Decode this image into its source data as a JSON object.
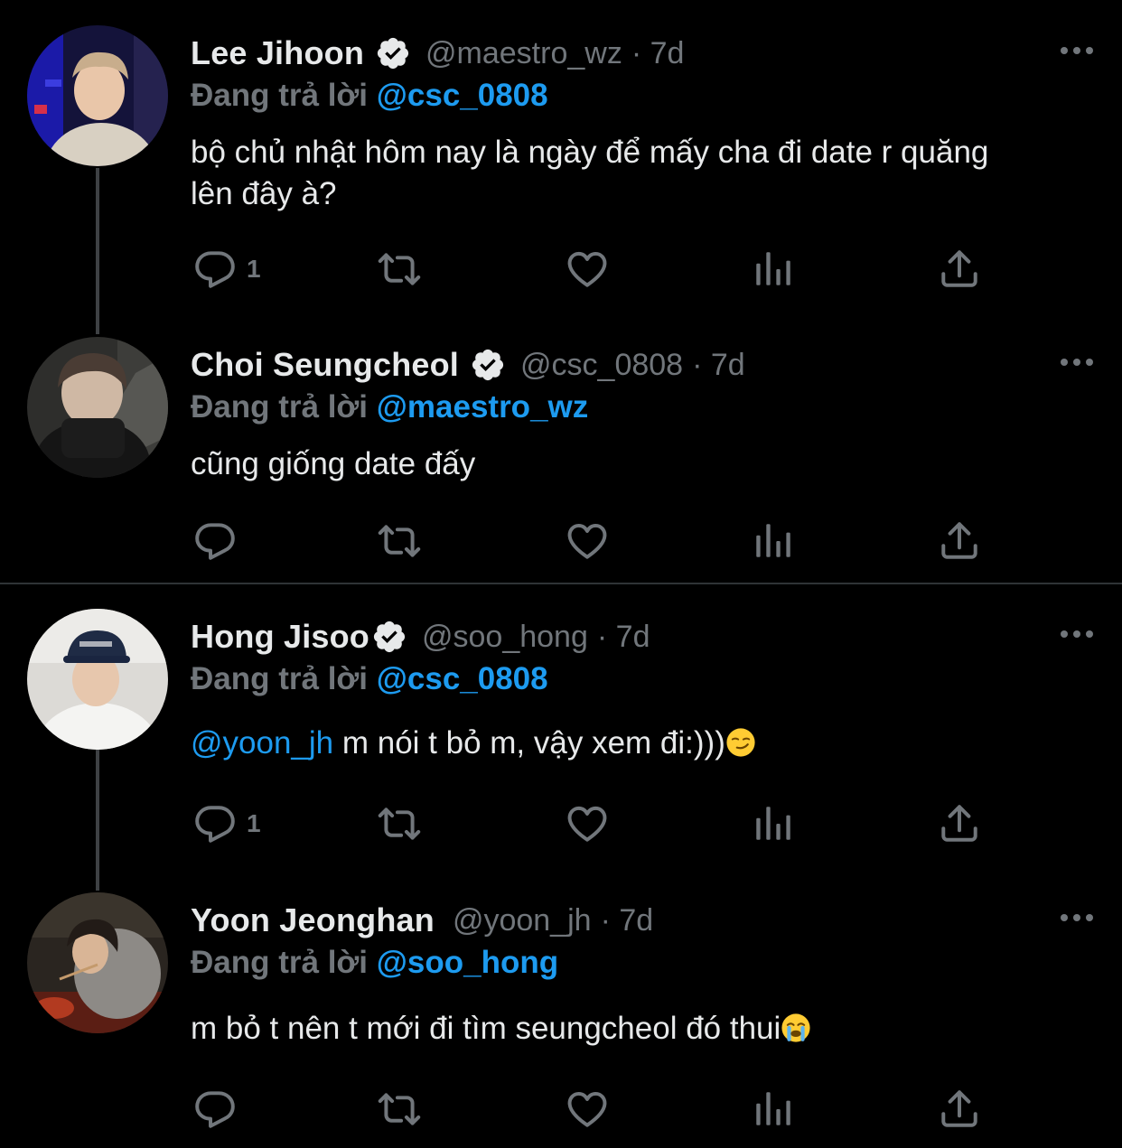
{
  "labels": {
    "replying_to": "Đang trả lời"
  },
  "colors": {
    "background": "#000000",
    "accent": "#1d9bf0",
    "muted": "#71767b",
    "text": "#e7e9ea"
  },
  "tweets": [
    {
      "name": "Lee Jihoon",
      "verified": true,
      "handle": "@maestro_wz",
      "time": "· 7d",
      "replying_to": "@csc_0808",
      "text": "bộ chủ nhật hôm nay là ngày để mấy cha đi date r quăng lên đây à?",
      "reply_count": "1",
      "avatar": "lee-jihoon-avatar"
    },
    {
      "name": "Choi Seungcheol",
      "verified": true,
      "handle": "@csc_0808",
      "time": "· 7d",
      "replying_to": "@maestro_wz",
      "text": "cũng giống date đấy",
      "reply_count": "",
      "avatar": "choi-seungcheol-avatar"
    },
    {
      "name": "Hong Jisoo",
      "verified": true,
      "handle": "@soo_hong",
      "time": "· 7d",
      "replying_to": "@csc_0808",
      "text_mention": "@yoon_jh",
      "text": " m nói t bỏ m, vậy xem đi:)))",
      "emoji": "smirk-emoji",
      "reply_count": "1",
      "avatar": "hong-jisoo-avatar"
    },
    {
      "name": "Yoon Jeonghan",
      "verified": false,
      "handle": "@yoon_jh",
      "time": "· 7d",
      "replying_to": "@soo_hong",
      "text": "m bỏ t nên t mới đi tìm seungcheol đó thui",
      "emoji": "crying-emoji",
      "reply_count": "",
      "avatar": "yoon-jeonghan-avatar"
    }
  ],
  "action_icons": [
    "reply-icon",
    "retweet-icon",
    "like-icon",
    "analytics-icon",
    "share-icon"
  ]
}
